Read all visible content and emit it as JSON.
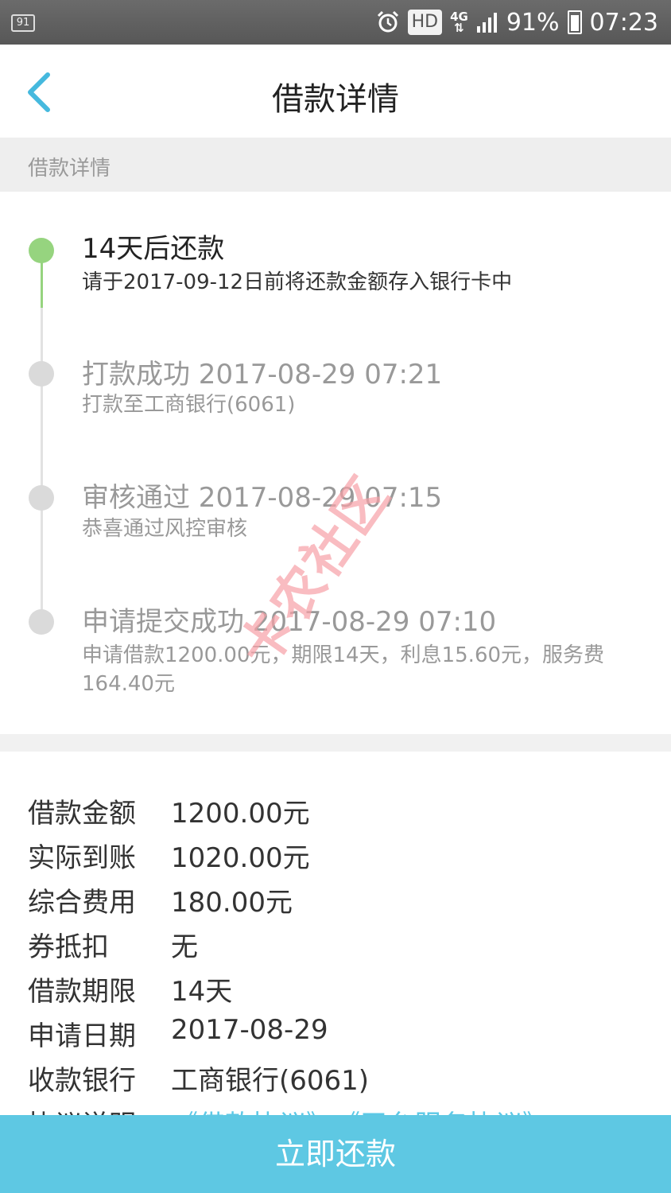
{
  "status_bar": {
    "notification_badge": "91",
    "hd_label": "HD",
    "network_label": "4G",
    "battery_percent": "91%",
    "time": "07:23"
  },
  "nav": {
    "title": "借款详情",
    "back_icon": "chevron-left-icon"
  },
  "section_header": "借款详情",
  "timeline": [
    {
      "title": "14天后还款",
      "desc": "请于2017-09-12日前将还款金额存入银行卡中",
      "status": "active",
      "color": "#96d47f"
    },
    {
      "title": "打款成功 2017-08-29 07:21",
      "desc": "打款至工商银行(6061)",
      "status": "done",
      "color": "#dadada"
    },
    {
      "title": "审核通过 2017-08-29 07:15",
      "desc": "恭喜通过风控审核",
      "status": "done",
      "color": "#dadada"
    },
    {
      "title": "申请提交成功 2017-08-29 07:10",
      "desc": "申请借款1200.00元，期限14天，利息15.60元，服务费164.40元",
      "status": "done",
      "color": "#dadada"
    }
  ],
  "details": [
    {
      "label": "借款金额",
      "value": "1200.00元"
    },
    {
      "label": "实际到账",
      "value": "1020.00元"
    },
    {
      "label": "综合费用",
      "value": "180.00元"
    },
    {
      "label": "券抵扣",
      "value": "无"
    },
    {
      "label": "借款期限",
      "value": "14天"
    },
    {
      "label": "申请日期",
      "value": "2017-08-29"
    },
    {
      "label": "收款银行",
      "value": "工商银行(6061)"
    },
    {
      "label": "协议说明",
      "value": "《借款协议》、《平台服务协议》"
    }
  ],
  "watermark": "卡农社区",
  "repay_button": "立即还款",
  "colors": {
    "accent": "#5ec8e3",
    "active_dot": "#96d47f",
    "inactive_dot": "#dadada",
    "watermark": "#f7a1a7"
  }
}
